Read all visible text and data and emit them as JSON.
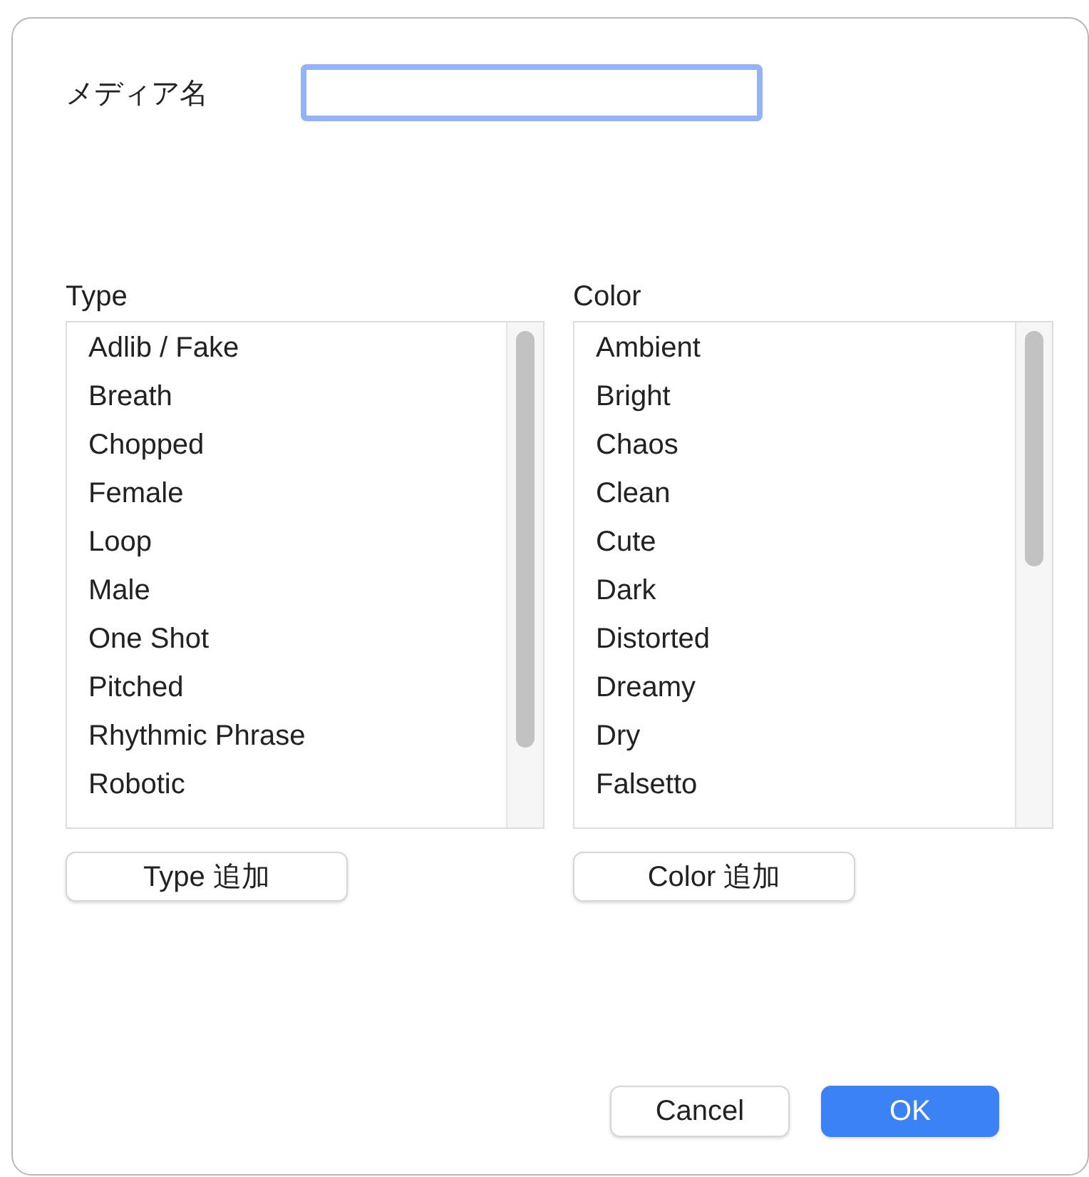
{
  "media_name": {
    "label": "メディア名",
    "focused": true
  },
  "lists": [
    {
      "title": "Type",
      "items": [
        "Adlib / Fake",
        "Breath",
        "Chopped",
        "Female",
        "Loop",
        "Male",
        "One Shot",
        "Pitched",
        "Rhythmic Phrase",
        "Robotic"
      ],
      "add_button": "Type 追加"
    },
    {
      "title": "Color",
      "items": [
        "Ambient",
        "Bright",
        "Chaos",
        "Clean",
        "Cute",
        "Dark",
        "Distorted",
        "Dreamy",
        "Dry",
        "Falsetto"
      ],
      "add_button": "Color 追加"
    }
  ],
  "buttons": {
    "cancel": "Cancel",
    "ok": "OK"
  }
}
